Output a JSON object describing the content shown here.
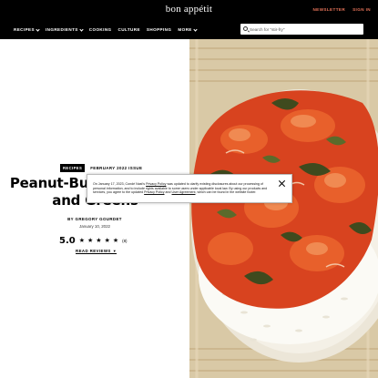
{
  "header": {
    "logo": "bon appétit",
    "newsletter": "NEWSLETTER",
    "signin": "SIGN IN"
  },
  "nav": {
    "items": [
      {
        "label": "RECIPES",
        "has_dropdown": true
      },
      {
        "label": "INGREDIENTS",
        "has_dropdown": true
      },
      {
        "label": "COOKING",
        "has_dropdown": false
      },
      {
        "label": "CULTURE",
        "has_dropdown": false
      },
      {
        "label": "SHOPPING",
        "has_dropdown": false
      },
      {
        "label": "MORE",
        "has_dropdown": true
      }
    ],
    "search_placeholder": "Search for \"stir-fry\""
  },
  "article": {
    "category": "RECIPES",
    "issue": "FEBRUARY 2022 ISSUE",
    "title": "Peanut-Butter Chicken and Greens",
    "byline": "BY GREGORY GOURDET",
    "date": "January 10, 2022",
    "rating": "5.0",
    "rating_stars": 5,
    "rating_count": "(8)",
    "read_reviews": "READ REVIEWS"
  },
  "banner": {
    "text_1": "On January 17, 2023, Condé Nast’s ",
    "link_1": "Privacy Policy",
    "text_2": " was updated to clarify existing disclosures about our processing of personal information, and to include rights available to some users under applicable local law. By using our products and services, you agree to the updated ",
    "link_2": "Privacy Policy",
    "text_3": " and ",
    "link_3": "User Agreement",
    "text_4": ", which can be found in the website footer."
  },
  "colors": {
    "header_bg": "#000000",
    "accent": "#e8745a"
  },
  "icons": [
    "search-icon",
    "chevron-down-icon",
    "star-icon",
    "close-icon"
  ]
}
